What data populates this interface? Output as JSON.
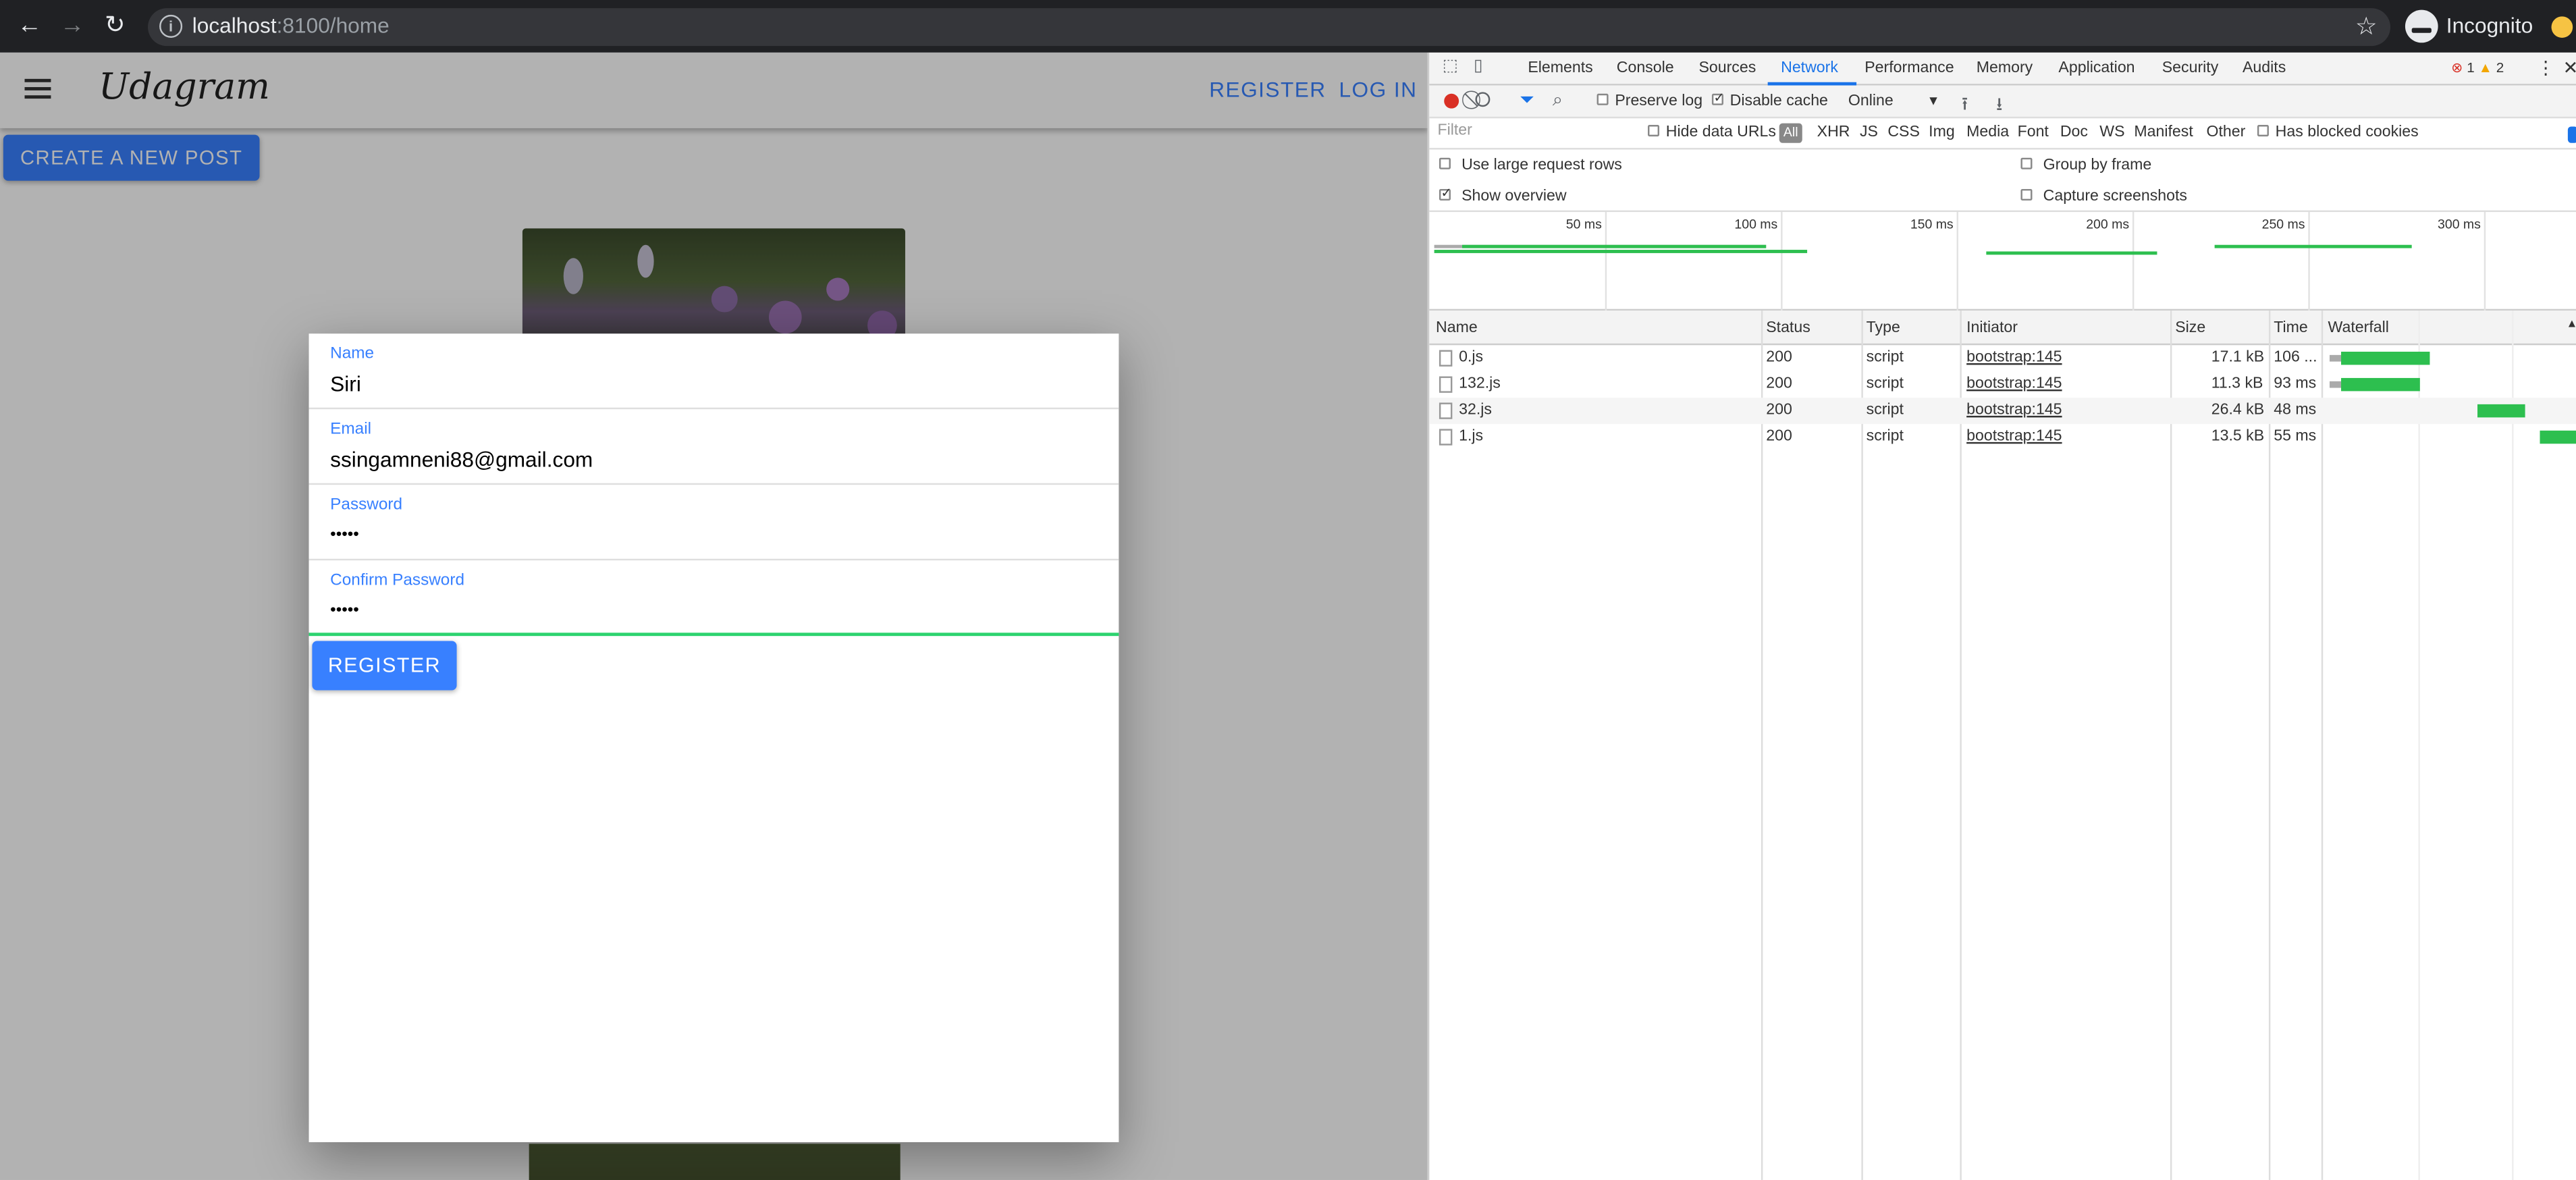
{
  "browser": {
    "url_host": "localhost",
    "url_path": ":8100/home",
    "profile_label": "Incognito",
    "icons": {
      "back": "back-arrow-icon",
      "forward": "forward-arrow-icon",
      "reload": "reload-icon",
      "info": "info-icon",
      "star": "bookmark-star-icon",
      "incognito": "incognito-icon"
    }
  },
  "app": {
    "logo": "Udagram",
    "header_register": "REGISTER",
    "header_login": "LOG IN",
    "create_post": "CREATE A NEW POST",
    "accent": "#3880ff",
    "form": {
      "name_label": "Name",
      "name_value": "Siri",
      "email_label": "Email",
      "email_value": "ssingamneni88@gmail.com",
      "password_label": "Password",
      "password_value": "•••••",
      "confirm_label": "Confirm Password",
      "confirm_value": "•••••",
      "submit": "REGISTER"
    }
  },
  "devtools": {
    "tabs": [
      "Elements",
      "Console",
      "Sources",
      "Network",
      "Performance",
      "Memory",
      "Application",
      "Security",
      "Audits"
    ],
    "active_tab": "Network",
    "error_count": "1",
    "warning_count": "2",
    "toolbar": {
      "preserve_log": "Preserve log",
      "disable_cache": "Disable cache",
      "throttle": "Online"
    },
    "filter": {
      "placeholder": "Filter",
      "hide_data_urls": "Hide data URLs",
      "all": "All",
      "types": [
        "XHR",
        "JS",
        "CSS",
        "Img",
        "Media",
        "Font",
        "Doc",
        "WS",
        "Manifest",
        "Other"
      ],
      "blocked": "Has blocked cookies"
    },
    "options": {
      "large_rows": "Use large request rows",
      "group_by_frame": "Group by frame",
      "show_overview": "Show overview",
      "capture_screenshots": "Capture screenshots"
    },
    "timeline_ticks": [
      "50 ms",
      "100 ms",
      "150 ms",
      "200 ms",
      "250 ms",
      "300 ms"
    ],
    "columns": [
      "Name",
      "Status",
      "Type",
      "Initiator",
      "Size",
      "Time",
      "Waterfall"
    ],
    "rows": [
      {
        "name": "0.js",
        "status": "200",
        "type": "script",
        "initiator": "bootstrap:145",
        "size": "17.1 kB",
        "time": "106 ..."
      },
      {
        "name": "132.js",
        "status": "200",
        "type": "script",
        "initiator": "bootstrap:145",
        "size": "11.3 kB",
        "time": "93 ms"
      },
      {
        "name": "32.js",
        "status": "200",
        "type": "script",
        "initiator": "bootstrap:145",
        "size": "26.4 kB",
        "time": "48 ms"
      },
      {
        "name": "1.js",
        "status": "200",
        "type": "script",
        "initiator": "bootstrap:145",
        "size": "13.5 kB",
        "time": "55 ms"
      }
    ]
  }
}
